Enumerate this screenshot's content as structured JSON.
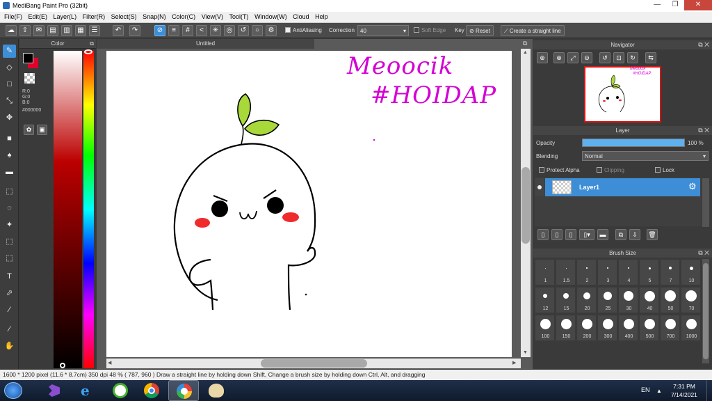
{
  "window": {
    "title": "MediBang Paint Pro (32bit)",
    "controls": {
      "minimize": "—",
      "maximize": "❐",
      "close": "✕"
    }
  },
  "menu": [
    "File(F)",
    "Edit(E)",
    "Layer(L)",
    "Filter(R)",
    "Select(S)",
    "Snap(N)",
    "Color(C)",
    "View(V)",
    "Tool(T)",
    "Window(W)",
    "Cloud",
    "Help"
  ],
  "toolbar": {
    "antialiasing_label": "AntiAliasing",
    "correction_label": "Correction",
    "correction_value": "40",
    "soft_edge_label": "Soft Edge",
    "key_label": "Key",
    "reset_label": "Reset",
    "straight_line_label": "Create a straight line"
  },
  "color_panel": {
    "title": "Color",
    "r": "R:0",
    "g": "G:0",
    "b": "B:0",
    "hex": "#000000",
    "foreground": "#000000",
    "background": "#e0002a"
  },
  "document": {
    "tab_title": "Untitled",
    "handwriting_line1": "Meoocik",
    "handwriting_line2": "#HOIDAP",
    "handwriting_color": "#d400d4"
  },
  "navigator": {
    "title": "Navigator",
    "thumb_line1": "Meoocik",
    "thumb_line2": "#HOIDAP"
  },
  "layer_panel": {
    "title": "Layer",
    "opacity_label": "Opacity",
    "opacity_value": "100 %",
    "opacity_fraction": 1.0,
    "blending_label": "Blending",
    "blending_value": "Normal",
    "protect_alpha_label": "Protect Alpha",
    "clipping_label": "Clipping",
    "lock_label": "Lock",
    "layers": [
      {
        "name": "Layer1"
      }
    ]
  },
  "brush_size": {
    "title": "Brush Size",
    "sizes": [
      "1",
      "1.5",
      "2",
      "3",
      "4",
      "5",
      "7",
      "10",
      "12",
      "15",
      "20",
      "25",
      "30",
      "40",
      "50",
      "70",
      "100",
      "150",
      "200",
      "300",
      "400",
      "500",
      "700",
      "1000"
    ]
  },
  "status": {
    "text": "1600 * 1200 pixel   (11.6 * 8.7cm)   350 dpi   48 %   ( 787, 960 )   Draw a straight line by holding down Shift, Change a brush size by holding down Ctrl, Alt, and dragging"
  },
  "taskbar": {
    "language": "EN",
    "time": "7:31 PM",
    "date": "7/14/2021"
  },
  "colors": {
    "accent": "#3d8ed6",
    "leaf": "#a8d83a"
  }
}
